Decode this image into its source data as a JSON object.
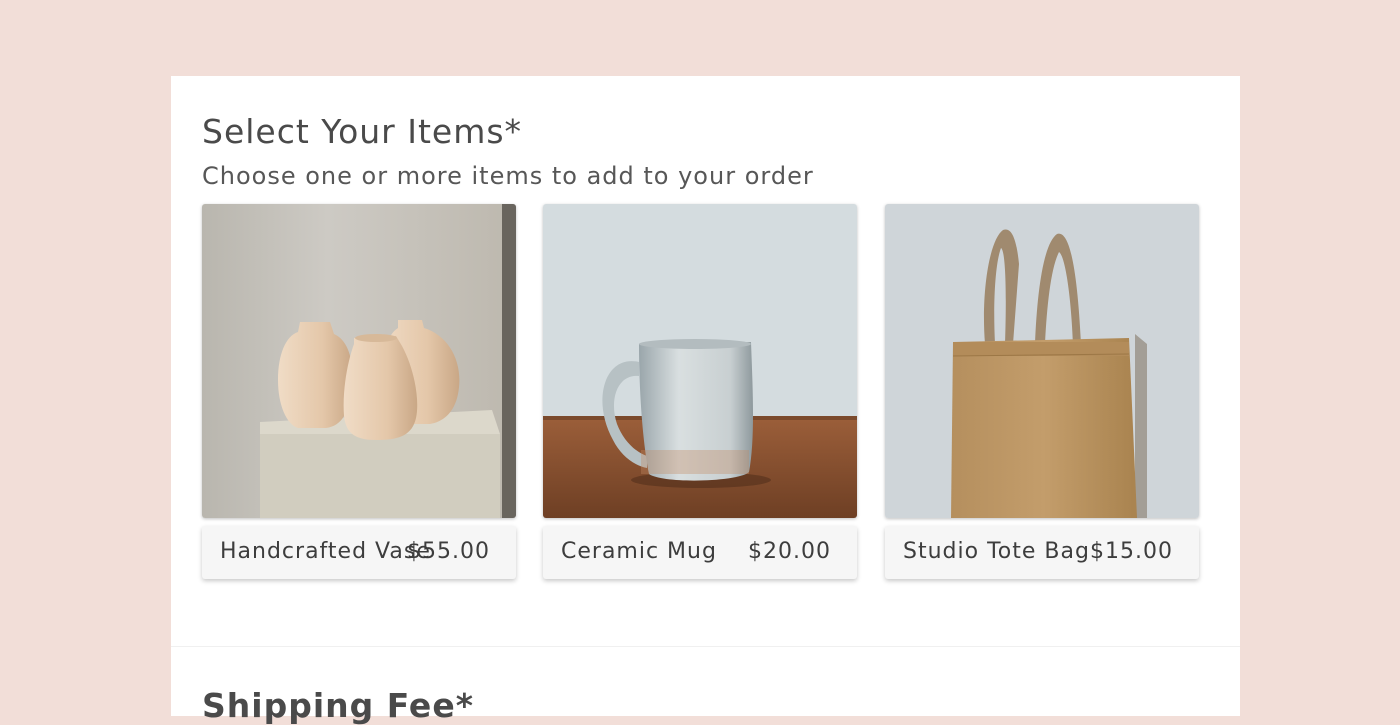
{
  "section": {
    "title": "Select Your Items*",
    "subtitle": "Choose one or more items to add to your order"
  },
  "items": [
    {
      "name": "Handcrafted Vase",
      "price": "$55.00",
      "image": "vases-photo"
    },
    {
      "name": "Ceramic Mug",
      "price": "$20.00",
      "image": "mug-photo"
    },
    {
      "name": "Studio Tote Bag",
      "price": "$15.00",
      "image": "tote-bag-photo"
    }
  ],
  "next_section": {
    "title": "Shipping Fee*"
  },
  "colors": {
    "page_background": "#f2ded8",
    "card_background": "#ffffff",
    "caption_background": "#f6f6f6",
    "text": "#4a4a4a"
  }
}
